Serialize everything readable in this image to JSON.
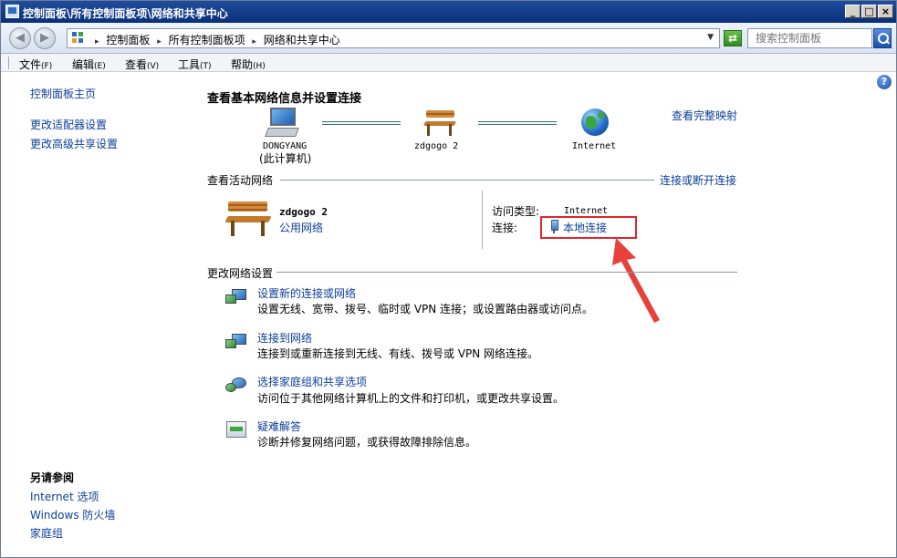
{
  "window": {
    "title": "控制面板\\所有控制面板项\\网络和共享中心",
    "min_label": "_",
    "max_label": "□",
    "close_label": "×"
  },
  "nav": {
    "crumbs": [
      "控制面板",
      "所有控制面板项",
      "网络和共享中心"
    ],
    "search_placeholder": "搜索控制面板"
  },
  "menu": [
    {
      "label": "文件",
      "key": "(F)"
    },
    {
      "label": "编辑",
      "key": "(E)"
    },
    {
      "label": "查看",
      "key": "(V)"
    },
    {
      "label": "工具",
      "key": "(T)"
    },
    {
      "label": "帮助",
      "key": "(H)"
    }
  ],
  "sidebar": {
    "home": "控制面板主页",
    "links": [
      "更改适配器设置",
      "更改高级共享设置"
    ],
    "see_also_title": "另请参阅",
    "see_also": [
      "Internet 选项",
      "Windows 防火墙",
      "家庭组"
    ]
  },
  "main": {
    "title": "查看基本网络信息并设置连接",
    "full_map": "查看完整映射",
    "nodes": {
      "computer": "DONGYANG",
      "computer_sub": "(此计算机)",
      "network": "zdgogo  2",
      "internet": "Internet"
    },
    "active_section": "查看活动网络",
    "connect_disconnect": "连接或断开连接",
    "active_network": {
      "name": "zdgogo  2",
      "type": "公用网络",
      "access_label": "访问类型:",
      "access_value": "Internet",
      "connection_label": "连接:",
      "connection_value": "本地连接"
    },
    "change_section": "更改网络设置",
    "tasks": [
      {
        "title": "设置新的连接或网络",
        "desc": "设置无线、宽带、拨号、临时或 VPN 连接；或设置路由器或访问点。"
      },
      {
        "title": "连接到网络",
        "desc": "连接到或重新连接到无线、有线、拨号或 VPN 网络连接。"
      },
      {
        "title": "选择家庭组和共享选项",
        "desc": "访问位于其他网络计算机上的文件和打印机，或更改共享设置。"
      },
      {
        "title": "疑难解答",
        "desc": "诊断并修复网络问题，或获得故障排除信息。"
      }
    ]
  },
  "colors": {
    "link": "#0b3f99",
    "highlight_box": "#e0262b",
    "annotation_arrow": "#e8403a"
  }
}
